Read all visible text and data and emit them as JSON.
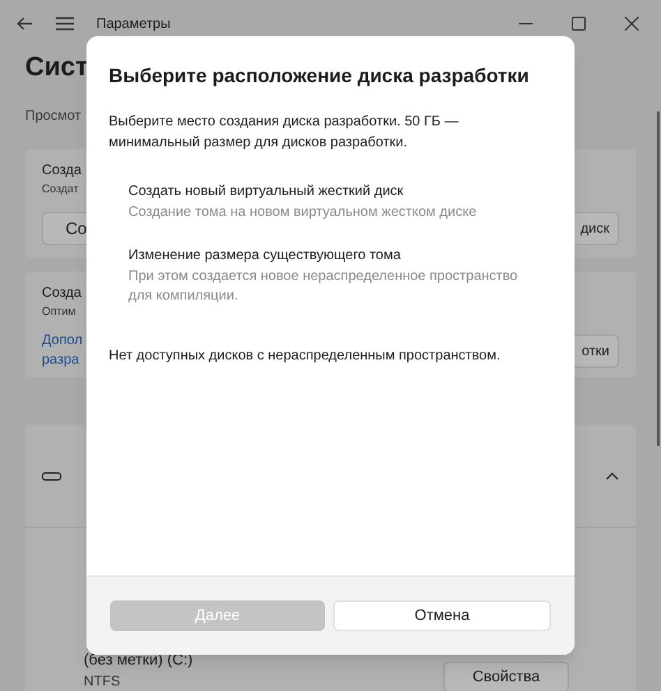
{
  "window": {
    "title": "Параметры"
  },
  "page": {
    "heading": "Сист",
    "subtitle": "Просмот"
  },
  "card_1": {
    "title": "Созда",
    "subtitle": "Создат",
    "left_button": "Со",
    "right_button": "диск"
  },
  "card_2": {
    "title": "Созда",
    "subtitle": "Оптим",
    "link": "Допол\nразра",
    "right_button": "отки"
  },
  "card_3": {
    "volume": "(без метки) (C:)",
    "filesystem": "NTFS",
    "button": "Свойства"
  },
  "dialog": {
    "title": "Выберите расположение диска разработки",
    "description": "Выберите место создания диска разработки. 50 ГБ — минимальный размер для дисков разработки.",
    "options": [
      {
        "title": "Создать новый виртуальный жесткий диск",
        "description": "Создание тома на новом виртуальном жестком диске"
      },
      {
        "title": "Изменение размера существующего тома",
        "description": "При этом создается новое нераспределенное пространство для компиляции."
      }
    ],
    "note": "Нет доступных дисков с нераспределенным пространством.",
    "buttons": [
      {
        "label": "Далее",
        "disabled": true
      },
      {
        "label": "Отмена",
        "disabled": false
      }
    ]
  }
}
